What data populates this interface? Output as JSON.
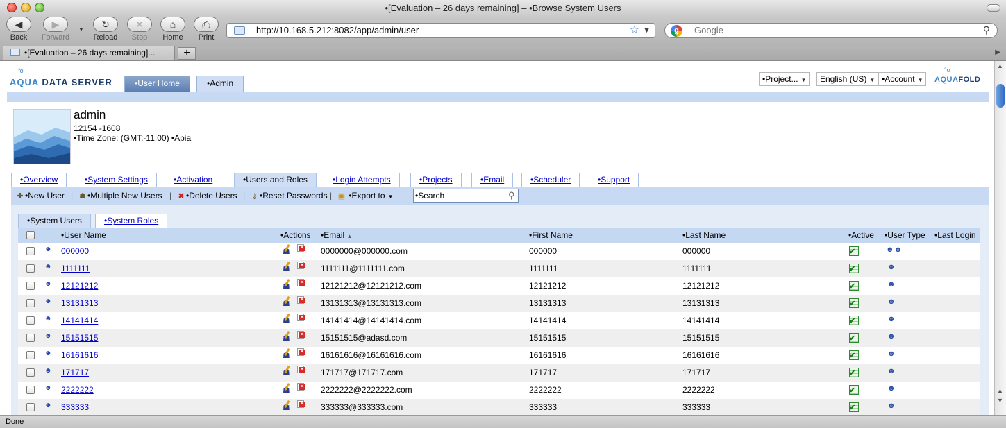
{
  "window": {
    "title": "•[Evaluation – 26 days remaining] – •Browse System Users"
  },
  "toolbar": {
    "back": "Back",
    "forward": "Forward",
    "reload": "Reload",
    "stop": "Stop",
    "home": "Home",
    "print": "Print",
    "url": "http://10.168.5.212:8082/app/admin/user",
    "search_placeholder": "Google"
  },
  "browser_tab": {
    "label": "•[Evaluation – 26 days remaining]...",
    "new_tab": "+"
  },
  "status": "Done",
  "app": {
    "brand_aqua": "AQUA",
    "brand_rest": " DATA SERVER",
    "tabs": [
      "•User Home",
      "•Admin"
    ],
    "project_menu": "•Project...",
    "language_menu": "English (US)",
    "account_menu": "•Account",
    "aquafold_aqua": "AQUA",
    "aquafold_rest": "FOLD"
  },
  "user": {
    "name": "admin",
    "code": "12154 -1608",
    "timezone": "•Time Zone: (GMT:-11:00) •Apia"
  },
  "admin_tabs": [
    "•Overview",
    "•System Settings",
    "•Activation",
    "•Users and Roles",
    "•Login Attempts",
    "•Projects",
    "•Email",
    "•Scheduler",
    "•Support"
  ],
  "actions": {
    "new_user": "•New User",
    "multiple_new_users": "•Multiple New Users",
    "delete_users": "•Delete Users",
    "reset_passwords": "•Reset Passwords",
    "export_to": "•Export to",
    "separator": "|",
    "search_value": "•Search"
  },
  "sub_tabs": [
    "•System Users",
    "•System Roles"
  ],
  "table": {
    "columns": [
      "•User Name",
      "•Actions",
      "•Email",
      "•First Name",
      "•Last Name",
      "•Active",
      "•User Type",
      "•Last Login"
    ],
    "sort_indicator": "▲",
    "rows": [
      {
        "username": "000000",
        "email": "0000000@000000.com",
        "first": "000000",
        "last": "000000",
        "type": "admin"
      },
      {
        "username": "1111111",
        "email": "1111111@1111111.com",
        "first": "1111111",
        "last": "1111111",
        "type": "user"
      },
      {
        "username": "12121212",
        "email": "12121212@12121212.com",
        "first": "12121212",
        "last": "12121212",
        "type": "user"
      },
      {
        "username": "13131313",
        "email": "13131313@13131313.com",
        "first": "13131313",
        "last": "13131313",
        "type": "user"
      },
      {
        "username": "14141414",
        "email": "14141414@14141414.com",
        "first": "14141414",
        "last": "14141414",
        "type": "user"
      },
      {
        "username": "15151515",
        "email": "15151515@adasd.com",
        "first": "15151515",
        "last": "15151515",
        "type": "user"
      },
      {
        "username": "16161616",
        "email": "16161616@16161616.com",
        "first": "16161616",
        "last": "16161616",
        "type": "user"
      },
      {
        "username": "171717",
        "email": "171717@171717.com",
        "first": "171717",
        "last": "171717",
        "type": "user"
      },
      {
        "username": "2222222",
        "email": "2222222@2222222.com",
        "first": "2222222",
        "last": "2222222",
        "type": "user"
      },
      {
        "username": "333333",
        "email": "333333@333333.com",
        "first": "333333",
        "last": "333333",
        "type": "user"
      }
    ]
  },
  "colors": {
    "accent_bar": "#c7d9f3",
    "link": "#0000cc",
    "active_green": "#2f8a2f"
  },
  "icons": {
    "user_row": "person-icon",
    "edit": "edit-user-icon",
    "delete": "delete-user-icon",
    "active": "active-check-icon",
    "admin_type": "admin-users-icon"
  }
}
